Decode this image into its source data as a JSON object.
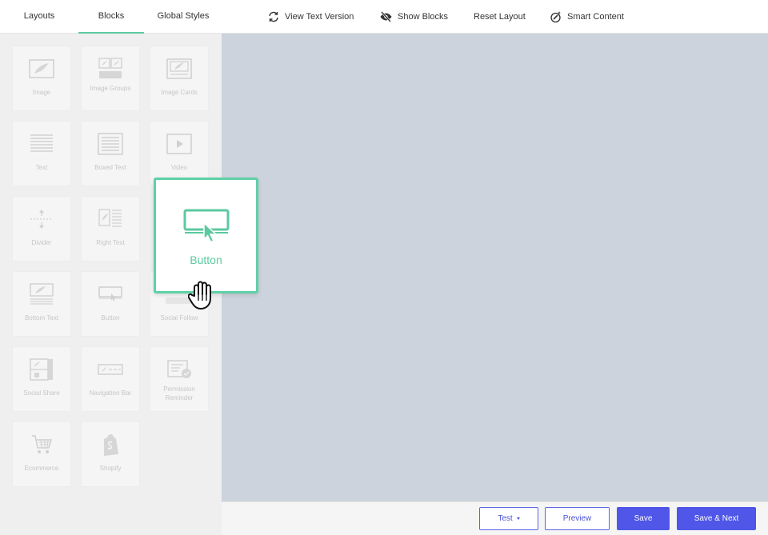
{
  "topbar": {
    "tabs": [
      {
        "label": "Layouts"
      },
      {
        "label": "Blocks",
        "active": true
      },
      {
        "label": "Global Styles"
      }
    ],
    "tools": [
      {
        "label": "View Text Version",
        "icon": "refresh-icon"
      },
      {
        "label": "Show Blocks",
        "icon": "eye-slash-icon"
      },
      {
        "label": "Reset Layout",
        "icon": ""
      },
      {
        "label": "Smart Content",
        "icon": "smart-content-icon"
      }
    ]
  },
  "blocks": [
    {
      "label": "Image",
      "icon": "image-icon"
    },
    {
      "label": "Image Groups",
      "icon": "image-groups-icon"
    },
    {
      "label": "Image Cards",
      "icon": "image-cards-icon"
    },
    {
      "label": "Text",
      "icon": "text-icon"
    },
    {
      "label": "Boxed Text",
      "icon": "boxed-text-icon"
    },
    {
      "label": "Video",
      "icon": "video-icon"
    },
    {
      "label": "Divider",
      "icon": "divider-icon"
    },
    {
      "label": "Right Text",
      "icon": "right-text-icon"
    },
    {
      "label": "Bottom Text",
      "icon": "bottom-text-icon"
    },
    {
      "label": "Button",
      "icon": "button-icon"
    },
    {
      "label": "Social Follow",
      "icon": "social-follow-icon"
    },
    {
      "label": "Social Share",
      "icon": "social-share-icon"
    },
    {
      "label": "Navigation Bar",
      "icon": "navigation-bar-icon"
    },
    {
      "label": "Permission Reminder",
      "icon": "permission-reminder-icon"
    },
    {
      "label": "Ecommerce",
      "icon": "cart-icon"
    },
    {
      "label": "Shopify",
      "icon": "shopify-icon"
    }
  ],
  "dragging": {
    "label": "Button",
    "icon": "button-icon",
    "cursor": "grab-hand-icon"
  },
  "bottombar": {
    "test_label": "Test",
    "preview_label": "Preview",
    "save_label": "Save",
    "save_next_label": "Save & Next"
  },
  "colors": {
    "accent": "#5cc9a0",
    "primary": "#4f56e8",
    "canvas": "#cdd3dc",
    "sidebar": "#efefef"
  }
}
